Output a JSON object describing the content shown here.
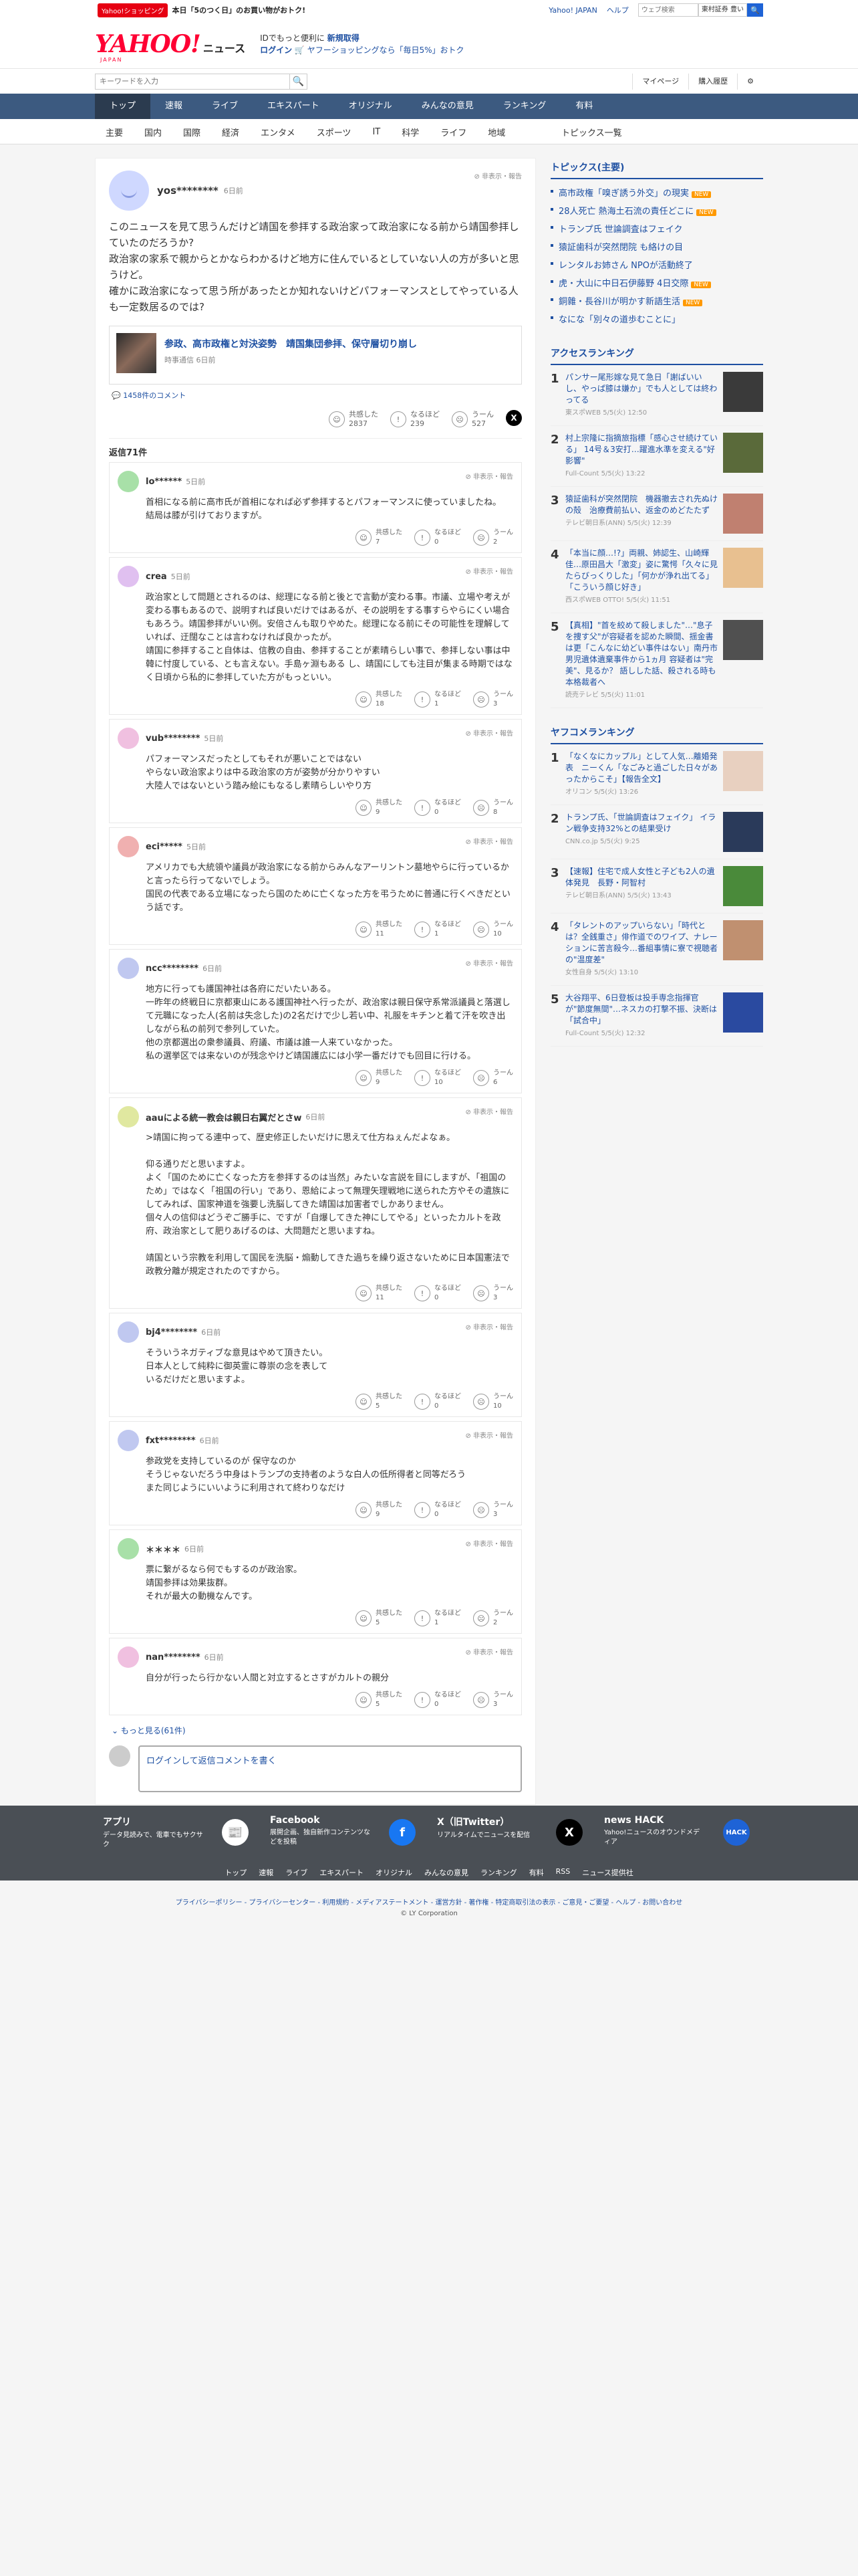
{
  "topbar": {
    "shop_badge": "Yahoo!ショッピング",
    "promo": "本日「5のつく日」のお買い物がおトク!",
    "yjapan": "Yahoo! JAPAN",
    "help": "ヘルプ",
    "search_placeholder": "ウェブ検索",
    "select": "東村証券 豊い",
    "search_btn": "🔍"
  },
  "header": {
    "logo": "YAHOO!",
    "logo_sub": "JAPAN",
    "logo_news": "ニュース",
    "line1_a": "IDでもっと便利に",
    "line1_b": "新規取得",
    "line2_a": "ログイン",
    "line2_b": "ヤフーショッピングなら「毎日5%」おトク"
  },
  "subbar": {
    "keyword_placeholder": "キーワードを入力",
    "mypage": "マイページ",
    "history": "購入履歴"
  },
  "gnav": [
    "トップ",
    "速報",
    "ライブ",
    "エキスパート",
    "オリジナル",
    "みんなの意見",
    "ランキング",
    "有料"
  ],
  "snav": [
    "主要",
    "国内",
    "国際",
    "経済",
    "エンタメ",
    "スポーツ",
    "IT",
    "科学",
    "ライフ",
    "地域"
  ],
  "snav_right": "トピックス一覧",
  "post": {
    "user": "yos********",
    "time": "6日前",
    "report": "非表示・報告",
    "body": "このニュースを見て思うんだけど靖国を参拝する政治家って政治家になる前から靖国参拝していたのだろうか?\n政治家の家系で親からとかならわかるけど地方に住んでいるとしていない人の方が多いと思うけど。\n確かに政治家になって思う所があったとか知れないけどパフォーマンスとしてやっている人も一定数居るのでは?",
    "article_title": "参政、高市政権と対決姿勢　靖国集団参拝、保守層切り崩し",
    "article_src": "時事通信 6日前",
    "comments": "1458件のコメント",
    "reacts": [
      {
        "label": "共感した",
        "count": "2837"
      },
      {
        "label": "なるほど",
        "count": "239"
      },
      {
        "label": "うーん",
        "count": "527"
      }
    ]
  },
  "replies_count": "返信71件",
  "replies": [
    {
      "user": "lo******",
      "time": "5日前",
      "color": "#a8e0a8",
      "body": "首相になる前に高市氏が首相になれば必ず参拝するとパフォーマンスに使っていましたね。\n結局は膝が引けておりますが。",
      "r": [
        "7",
        "0",
        "2"
      ]
    },
    {
      "user": "crea",
      "time": "5日前",
      "color": "#e0c0f0",
      "body": "政治家として問題とされるのは、総理になる前と後とで言動が変わる事。市議、立場や考えが変わる事もあるので、説明すれば良いだけではあるが、その説明をする事すらやらにくい場合もあろう。靖国参拝がいい例。安倍さんも取りやめた。総理になる前にその可能性を理解していれば、迂闊なことは言わなければ良かったが。\n靖国に参拝すること自体は、信教の自由、参拝することが素晴らしい事で、参拝しない事は中韓に忖度している、とも言えない。手島ヶ淵もある し、靖国にしても注目が集まる時期ではなく日頃から私的に参拝していた方がもっといい。",
      "r": [
        "18",
        "1",
        "3"
      ]
    },
    {
      "user": "vub********",
      "time": "5日前",
      "color": "#f0c0e0",
      "body": "パフォーマンスだったとしてもそれが悪いことではない\nやらない政治家よりは中る政治家の方が姿勢が分かりやすい\n大陸人ではないという踏み絵にもなるし素晴らしいやり方",
      "r": [
        "9",
        "0",
        "8"
      ]
    },
    {
      "user": "eci*****",
      "time": "5日前",
      "color": "#f0b0b0",
      "body": "アメリカでも大統領や議員が政治家になる前からみんなアーリントン墓地やらに行っているかと言ったら行ってないでしょう。\n国民の代表である立場になったら国のために亡くなった方を弔うために普通に行くべきだという話です。",
      "r": [
        "11",
        "1",
        "10"
      ]
    },
    {
      "user": "ncc********",
      "time": "6日前",
      "color": "#c0c8f0",
      "body": "地方に行っても護国神社は各府にだいたいある。\n一昨年の終戦日に京都東山にある護国神社へ行ったが、政治家は親日保守系常派議員と落選して元職になった人(名前は失念した)の2名だけで少し若い中、礼服をキチンと着て汗を吹き出しながら私の前列で参列していた。\n他の京都選出の衆参議員、府議、市議は誰一人来ていなかった。\n私の選挙区では来ないのが残念やけど靖国護広には小学一番だけでも回目に行ける。",
      "r": [
        "9",
        "10",
        "6"
      ]
    },
    {
      "user": "aauによる統一教会は親日右翼だとさw",
      "time": "6日前",
      "color": "#e0e8a0",
      "body": ">靖国に拘ってる連中って、歴史修正したいだけに思えて仕方ねぇんだよなぁ。\n\n仰る通りだと思いますよ。\nよく「国のために亡くなった方を参拝するのは当然」みたいな言説を目にしますが、「祖国のため」ではなく「祖国の行い」であり、恩給によって無理矢理戦地に送られた方やその遺族にしてみれば、国家神道を強要し洗脳してきた靖国は加害者でしかありません。\n個々人の信仰はどうぞご勝手に、ですが「自爆してきた神にしてやる」といったカルトを政府、政治家として肥りあげるのは、大問題だと思いますね。\n\n靖国という宗教を利用して国民を洗脳・煽動してきた過ちを繰り返さないために日本国憲法で政教分離が規定されたのですから。",
      "r": [
        "11",
        "0",
        "3"
      ]
    },
    {
      "user": "bj4********",
      "time": "6日前",
      "color": "#c0c8f0",
      "body": "そういうネガティブな意見はやめて頂きたい。\n日本人として純粋に御英霊に尊崇の念を表して\nいるだけだと思いますよ。",
      "r": [
        "5",
        "0",
        "10"
      ]
    },
    {
      "user": "fxt********",
      "time": "6日前",
      "color": "#c0c8f0",
      "body": "参政党を支持しているのが 保守なのか\nそうじゃないだろう中身はトランプの支持者のような白人の低所得者と同等だろう\nまた同じようにいいように利用されて終わりなだけ",
      "r": [
        "9",
        "0",
        "3"
      ]
    },
    {
      "user": "＊＊＊＊",
      "time": "6日前",
      "color": "#a8e0a8",
      "body": "票に繋がるなら何でもするのが政治家。\n靖国参拝は効果抜群。\nそれが最大の動機なんです。",
      "r": [
        "5",
        "1",
        "2"
      ]
    },
    {
      "user": "nan********",
      "time": "6日前",
      "color": "#f0c0e0",
      "body": "自分が行ったら行かない人間と対立するとさすがカルトの親分",
      "r": [
        "5",
        "0",
        "3"
      ]
    }
  ],
  "more_replies": "もっと見る(61件)",
  "reply_placeholder": "ログインして返信コメントを書く",
  "sidebar": {
    "topics_h": "トピックス(主要)",
    "topics": [
      {
        "t": "高市政権「嗅ぎ誘う外交」の現実",
        "n": "NEW"
      },
      {
        "t": "28人死亡 熱海土石流の責任どこに",
        "n": "NEW"
      },
      {
        "t": "トランプ氏 世論調査はフェイク",
        "n": ""
      },
      {
        "t": "猿証歯科が突然閉院 も絡けの目",
        "n": ""
      },
      {
        "t": "レンタルお姉さん NPOが活動終了",
        "n": ""
      },
      {
        "t": "虎・大山に中日石伊藤野 4日交際",
        "n": "NEW"
      },
      {
        "t": "銅雜・長谷川が明かす新語生活",
        "n": "NEW"
      },
      {
        "t": "なにな「別々の道歩むことに」",
        "n": ""
      }
    ],
    "access_h": "アクセスランキング",
    "access": [
      {
        "n": "1",
        "t": "パンサー尾形嫁な見て急日「謝ばいいし、やっぱ膝は嫌か」でも人としては終わってる",
        "s": "東スポWEB 5/5(火) 12:50",
        "c": "#3a3a3a"
      },
      {
        "n": "2",
        "t": "村上宗隆に指摘旅指標「感心させ続けている」 14号＆3安打…躍進水準を変える\"好影響\"",
        "s": "Full-Count 5/5(火) 13:22",
        "c": "#5a6a3a"
      },
      {
        "n": "3",
        "t": "猿証歯科が突然閉院　機器撤去され先ぬけの殻　治療費前払い、返金のめどたたず",
        "s": "テレビ朝日系(ANN) 5/5(火) 12:39",
        "c": "#c08070"
      },
      {
        "n": "4",
        "t": "「本当に顔…!?」両親、姉認生、山崎輝佳…原田昌大「激変」姿に驚愕「久々に見たらびっくりした」「何かが浄れ出てる」「こういう顔じ好き」",
        "s": "西スポWEB OTTO! 5/5(火) 11:51",
        "c": "#e8c090"
      },
      {
        "n": "5",
        "t": "【真相】\"首を絞めて殺しました\"…\"息子を捜す父\"が容疑者を認めた瞬間、揺金書は更「こんなに幼どい事件はない」南丹市男児遺体遺棄事件から1ヵ月 容疑者は\"完美\"、見るか？ 語しした話、殺される時も本格裁者へ",
        "s": "読売テレビ 5/5(火) 11:01",
        "c": "#505050"
      }
    ],
    "yahoo_h": "ヤフコメランキング",
    "yahoo": [
      {
        "n": "1",
        "t": "「なくなにカップル」として人気…離婚発表　ニーくん「なごみと過ごした日々があったからこそ」【報告全文】",
        "s": "オリコン 5/5(火) 13:26",
        "c": "#e8d0c0"
      },
      {
        "n": "2",
        "t": "トランプ氏、「世論調査はフェイク」 イラン戦争支持32%との結果受け",
        "s": "CNN.co.jp 5/5(火) 9:25",
        "c": "#2a3a5a"
      },
      {
        "n": "3",
        "t": "【速報】住宅で成人女性と子ども2人の遺体発見　長野・阿智村",
        "s": "テレビ朝日系(ANN) 5/5(火) 13:43",
        "c": "#4a8a3a"
      },
      {
        "n": "4",
        "t": "「タレントのアップいらない」「時代とは？全銭重さ」俳作道でのワイプ、ナレーションに苦言殺今…番組事情に寮で視聴者の\"温度差\"",
        "s": "女性自身 5/5(火) 13:10",
        "c": "#c09070"
      },
      {
        "n": "5",
        "t": "大谷翔平、6日登板は投手専念指揮官が\"節度無間\"…ネスカの打撃不振、決断は「試合中」",
        "s": "Full-Count 5/5(火) 12:32",
        "c": "#2a4aa0"
      }
    ]
  },
  "footer": {
    "cols": [
      {
        "h": "アプリ",
        "s": "データ見読みで、電車でもサクサク",
        "ic": "📰",
        "bg": "#fff",
        "fg": "#1e50a2"
      },
      {
        "h": "Facebook",
        "s": "展開企画、独自新作コンテンツなどを投稿",
        "ic": "f",
        "bg": "#1877f2",
        "fg": "#fff"
      },
      {
        "h": "X（旧Twitter）",
        "s": "リアルタイムでニュースを配信",
        "ic": "X",
        "bg": "#000",
        "fg": "#fff"
      },
      {
        "h": "news HACK",
        "s": "Yahoo!ニュースのオウンドメディア",
        "ic": "HACK",
        "bg": "#1e63d6",
        "fg": "#fff"
      }
    ],
    "links": [
      "トップ",
      "速報",
      "ライブ",
      "エキスパート",
      "オリジナル",
      "みんなの意見",
      "ランキング",
      "有料",
      "RSS",
      "ニュース提供社"
    ],
    "legal": "プライバシーポリシー - プライバシーセンター - 利用規約 - メディアステートメント - 運営方針 - 著作権 - 特定商取引法の表示 - ご意見・ご要望 - ヘルプ - お問い合わせ",
    "copy": "© LY Corporation"
  },
  "colors": {
    "accent": "#1e50a2",
    "nav": "#3c5a80",
    "brand": "#ff0033"
  }
}
